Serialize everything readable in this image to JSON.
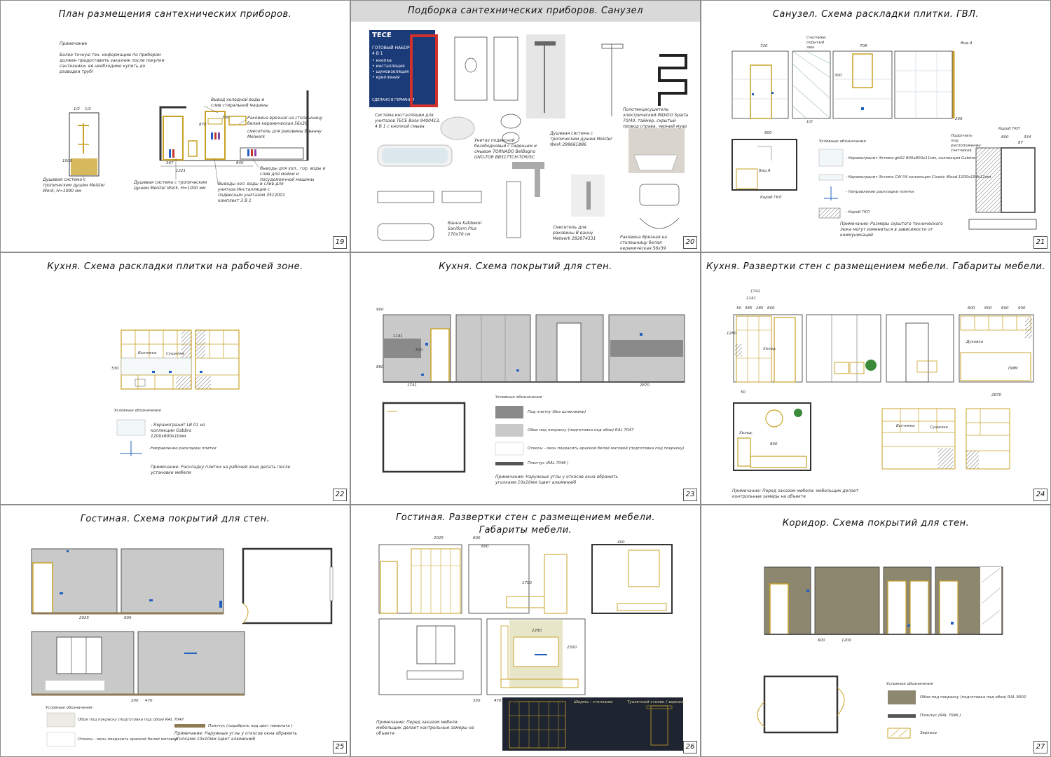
{
  "sheets": [
    {
      "id": "19",
      "title": "План размещения сантехнических приборов.",
      "number": "19",
      "note_title": "Примечание",
      "note_body": "Более точную тех. информацию по приборам должен предоставить заказчик после покупки сантехники, её необходимо купить до разводки труб!",
      "callouts": [
        "Вывод холодной воды и слив стиральной машины",
        "Раковина врезная на столешницу белая керамическая 56х39",
        "смеситель для раковины В ванну Melwerk",
        "Выводы для хол., гор. воды и слив для мойки и посудомоечной машины",
        "Душевая система с тропическим душем Meister Werk, H=1000 мм",
        "Выводы хол. воды и слив для унитаза Инсталляция с подвесным унитазом 3512001 комплект 3 В 1",
        "Душевая система с тропическим душем Meister Werk, H=1000 мм"
      ],
      "dims": [
        "1/2",
        "1/2",
        "1000",
        "870",
        "367",
        "1221",
        "840",
        "300"
      ]
    },
    {
      "id": "20",
      "title": "Подборка сантехнических приборов. Санузел",
      "number": "20",
      "tece_brand": "TECE",
      "tece_lines": [
        "ГОТОВЫЙ НАБОР",
        "4 В 1",
        "• кнопка",
        "• инсталляция",
        "• шумоизоляция",
        "• крепления",
        "СДЕЛАНО В ГЕРМАНИИ"
      ],
      "captions": [
        "Система инсталляции для унитазов TECE Base 9400413, 4 В 1 с кнопкой смыва",
        "Унитаз подвесной безободковый с сиденьем и смывом TORNADO BelBagno UNO-TOR BB517TCH-TOR/SC",
        "Душевая система с тропическим душем Meister Werk 299661886",
        "Полотенцесушитель электрический INDIGO Sparta 70/40, таймер, скрытый провод справа, черный муар",
        "Ванна Kaldewei Saniform Plus 170х70 см",
        "Смеситель для раковины В ванну Melwerk 282874331",
        "Раковина Врезная на столешницу белая керамическая 56х39"
      ]
    },
    {
      "id": "21",
      "title": "Санузел. Схема раскладки плитки. ГВЛ.",
      "number": "21",
      "labels": [
        "Счетчики скрытый люк",
        "Вид А",
        "Подогнать под расположение счетчиков",
        "Короб ГКЛ",
        "Короб ГКЛ",
        "Вид А"
      ],
      "legend_title": "Условные обозначения",
      "legend": [
        "- Керамогранит Эстима gb02 800x800x11мм, коллекция Gabbro",
        "- Керамогранит Эстима CW 04 коллекция Classic Wood 1200x194x11мм",
        "- Направление раскладки плитки",
        "- Короб ГКЛ"
      ],
      "note": "Примечание: Размеры скрытого технического люка могут измениться в зависимости от коммуникаций",
      "dims": [
        "720",
        "708",
        "800",
        "1/2",
        "300",
        "200",
        "800",
        "334",
        "87"
      ]
    },
    {
      "id": "22",
      "title": "Кухня. Схема раскладки плитки на рабочей зоне.",
      "number": "22",
      "labels": [
        "Вытяжка",
        "Сушилка",
        "530"
      ],
      "legend_title": "Условные обозначения",
      "legend": [
        "- Керамогранит LB 01 из коллекции Gabbro 1200x600x10мм",
        "-Направление раскладки плитки"
      ],
      "note": "Примечание: Раскладку плитки на рабочей зоне делать после установки мебели"
    },
    {
      "id": "23",
      "title": "Кухня. Схема покрытий для стен.",
      "number": "23",
      "legend_title": "Условные обозначения",
      "legend": [
        "Под плитку (без шпаклевки)",
        "Обои под покраску (подготовка под обои) RAL 7047",
        "Откосы - окон покрасить краской белой матовой (подготовка под покраску)",
        "Плинтус (RAL 7046 )"
      ],
      "note": "Примечание: Наружные углы у откосов окна обрамить уголками 10x10мм (цвет алюминий)",
      "dims": [
        "1741",
        "2870",
        "900",
        "1141",
        "530",
        "860"
      ]
    },
    {
      "id": "24",
      "title": "Кухня. Развертки стен с размещением мебели. Габариты мебели.",
      "number": "24",
      "labels": [
        "Холод",
        "Вытяжка",
        "Сушилка",
        "Духовка",
        "ПММ",
        "Холод."
      ],
      "note": "Примечание: Перед заказом мебели, мебельщик делает контрольные замеры на объекте",
      "dims": [
        "1741",
        "1141",
        "50",
        "385",
        "285",
        "600",
        "600",
        "600",
        "600",
        "900",
        "2870",
        "1280",
        "800",
        "50"
      ]
    },
    {
      "id": "25",
      "title": "Гостиная. Схема покрытий для стен.",
      "number": "25",
      "legend_title": "Условные обозначения",
      "legend": [
        "Обои под покраску (подготовка под обои) RAL 7047",
        "Откосы - окон покрасить краской белой матовой",
        "Плинтус (подобрать под цвет ламината )"
      ],
      "note": "Примечание: Наружные углы у откосов окна обрамить уголками 10x10мм (цвет алюминий)",
      "dims": [
        "2025",
        "600",
        "200",
        "470"
      ]
    },
    {
      "id": "26",
      "title_line1": "Гостиная. Развертки стен с размещением мебели.",
      "title_line2": "Габариты мебели.",
      "number": "26",
      "note": "Примечание: Перед заказом мебели, мебельщик делает контрольные замеры на объекте",
      "dark_labels": [
        "Ширмы - стеллажи",
        "Туалетный столик / зеркало"
      ],
      "dims": [
        "2025",
        "600",
        "400",
        "1700",
        "2280",
        "600",
        "2300",
        "350",
        "470",
        "1200"
      ]
    },
    {
      "id": "27",
      "title": "Коридор. Схема покрытий для стен.",
      "number": "27",
      "legend_title": "Условные обозначения",
      "legend": [
        "Обои под покраску (подготовка под обои) RAL 9002",
        "Плинтус (RAL 7046 )",
        "Зеркало"
      ],
      "dims": [
        "600",
        "1200"
      ]
    }
  ],
  "colors": {
    "gold": "#c9a227",
    "blue": "#1f5fbf",
    "wall_grey": "#c9c9c9",
    "tile_grey": "#8a8a8a",
    "khaki": "#8e8770",
    "dark_panel": "#1e2430"
  }
}
